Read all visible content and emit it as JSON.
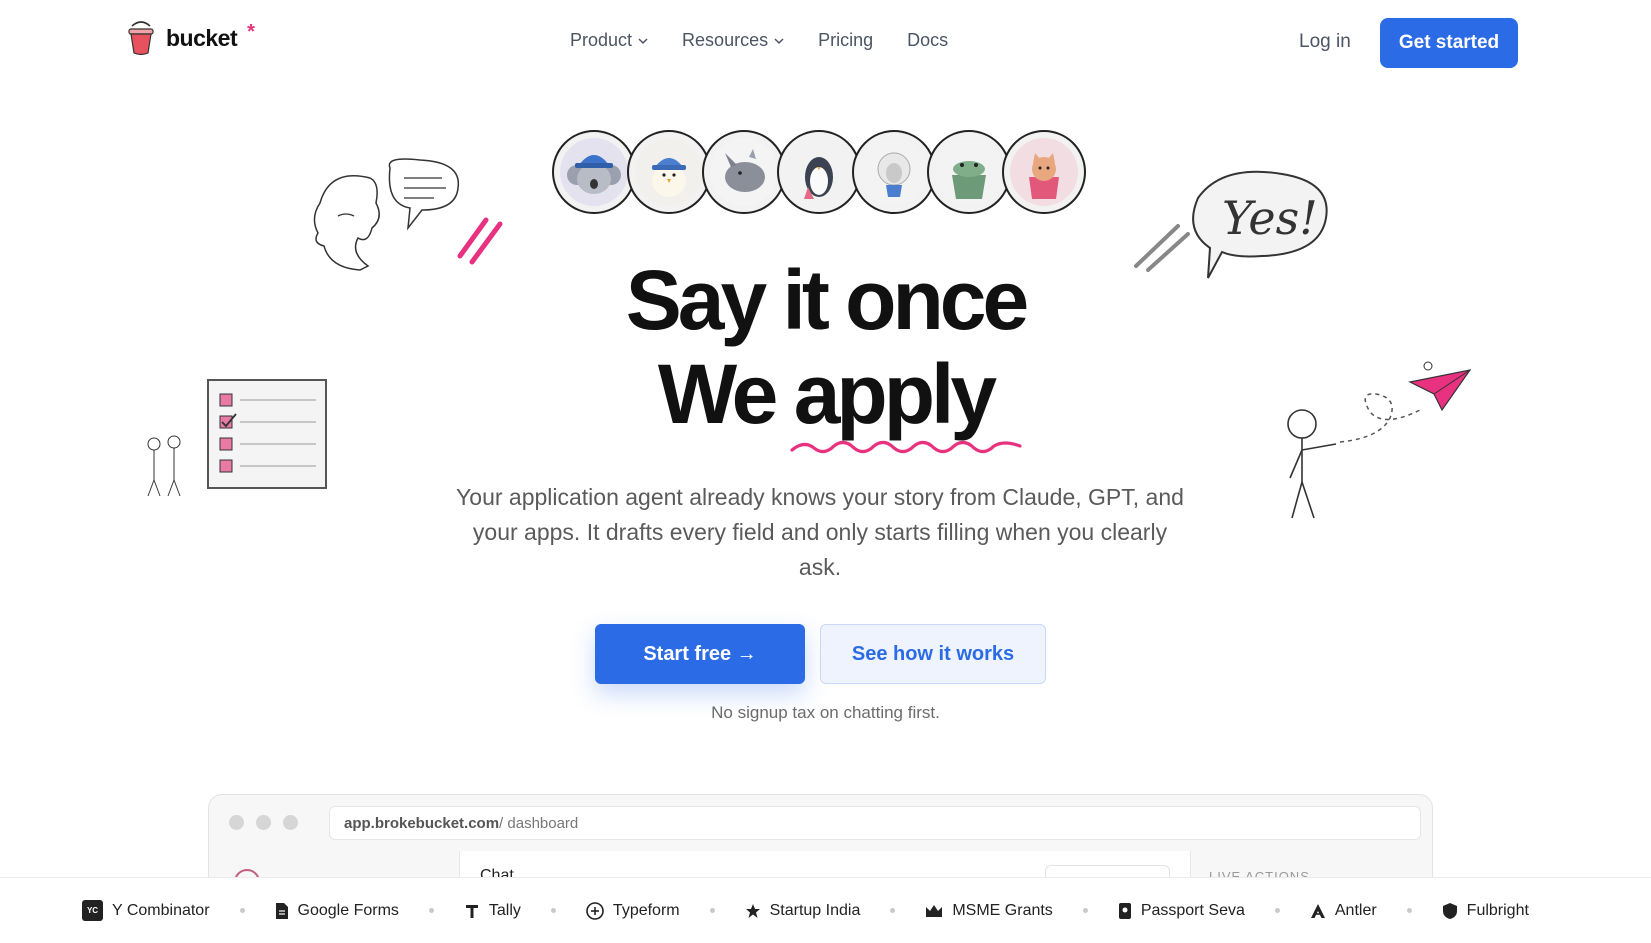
{
  "brand": {
    "name": "bucket",
    "star": "*",
    "accent": "#e8317f",
    "primary": "#2b6be6"
  },
  "nav": {
    "items": [
      {
        "label": "Product",
        "dropdown": true
      },
      {
        "label": "Resources",
        "dropdown": true
      },
      {
        "label": "Pricing",
        "dropdown": false
      },
      {
        "label": "Docs",
        "dropdown": false
      }
    ],
    "login": "Log in",
    "get_started": "Get started"
  },
  "avatars": [
    "koala-in-bucket-hat",
    "chick-in-bucket-hat",
    "rhino",
    "penguin-with-bucket",
    "sheep-with-bucket",
    "crocodile-in-bucket",
    "cat-in-bucket"
  ],
  "hero": {
    "line1": "Say it once",
    "line2_a": "We ",
    "line2_b": "apply",
    "subtitle": "Your application agent already knows your story from Claude, GPT, and your apps. It drafts every field and only starts filling when you clearly ask.",
    "primary_button": "Start free →",
    "secondary_button": "See how it works",
    "note": "No signup tax on chatting first."
  },
  "doodles": {
    "yes_bubble": "Yes!"
  },
  "preview": {
    "url_domain": "app.brokebucket.com",
    "url_path": " / dashboard",
    "chat_label": "Chat",
    "live_label": "LIVE ACTIONS"
  },
  "logos": [
    {
      "label": "Y Combinator",
      "icon": "yc-icon"
    },
    {
      "label": "Google Forms",
      "icon": "document-icon"
    },
    {
      "label": "Tally",
      "icon": "tally-icon"
    },
    {
      "label": "Typeform",
      "icon": "plus-circle-icon"
    },
    {
      "label": "Startup India",
      "icon": "star-icon"
    },
    {
      "label": "MSME Grants",
      "icon": "crown-icon"
    },
    {
      "label": "Passport Seva",
      "icon": "passport-icon"
    },
    {
      "label": "Antler",
      "icon": "antler-icon"
    },
    {
      "label": "Fulbright",
      "icon": "shield-icon"
    }
  ]
}
